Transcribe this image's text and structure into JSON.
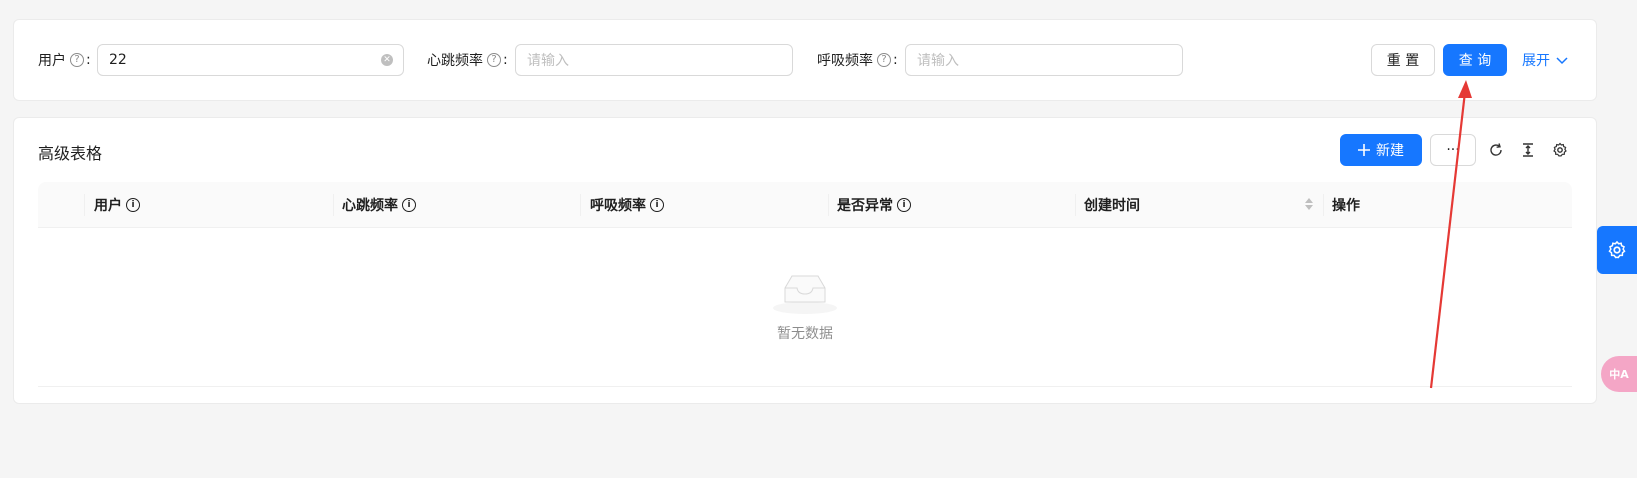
{
  "search": {
    "user_label": "用户",
    "user_value": "22",
    "heartrate_label": "心跳频率",
    "heartrate_placeholder": "请输入",
    "breath_label": "呼吸频率",
    "breath_placeholder": "请输入",
    "reset_label": "重 置",
    "query_label": "查 询",
    "expand_label": "展开",
    "colon": ":",
    "help_glyph": "?"
  },
  "table": {
    "title": "高级表格",
    "new_label": "新建",
    "more_label": "···",
    "columns": [
      "用户",
      "心跳频率",
      "呼吸频率",
      "是否异常",
      "创建时间",
      "操作"
    ],
    "info_glyph": "i",
    "empty_text": "暂无数据"
  },
  "floating": {
    "translate_label": "中A"
  },
  "colors": {
    "primary": "#1677ff",
    "annotation_arrow": "#e53935",
    "translate_bg": "#f4a6c6"
  }
}
